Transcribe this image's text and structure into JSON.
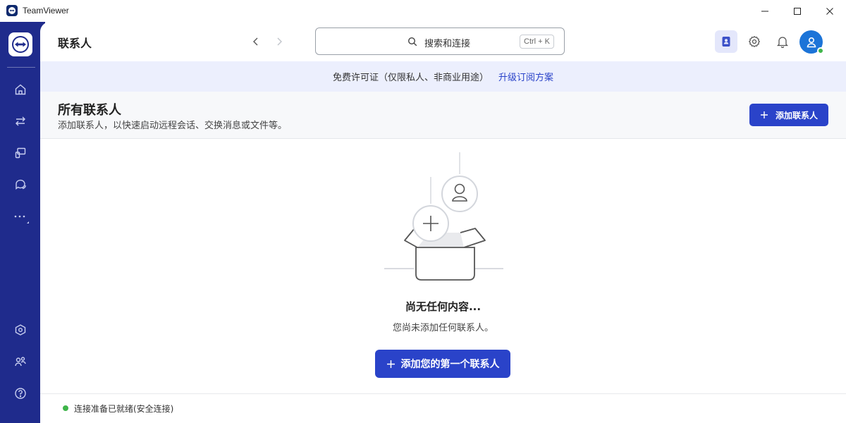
{
  "window": {
    "title": "TeamViewer",
    "controls": [
      "minimize-icon",
      "maximize-icon",
      "close-icon"
    ]
  },
  "sidebar": {
    "logo": "teamviewer-logo-icon",
    "items": [
      {
        "icon": "home-icon"
      },
      {
        "icon": "transfer-arrows-icon"
      },
      {
        "icon": "remote-device-icon"
      },
      {
        "icon": "chat-icon"
      },
      {
        "icon": "more-icon"
      }
    ],
    "bottom_items": [
      {
        "icon": "settings-shield-icon"
      },
      {
        "icon": "people-icon"
      },
      {
        "icon": "help-icon"
      }
    ]
  },
  "header": {
    "title": "联系人",
    "search_placeholder": "搜索和连接",
    "search_shortcut": "Ctrl + K",
    "icons": [
      "contacts-book-icon",
      "gear-icon",
      "bell-icon",
      "user-avatar-icon"
    ]
  },
  "banner": {
    "text": "免费许可证（仅限私人、非商业用途）",
    "link": "升级订阅方案"
  },
  "section": {
    "title": "所有联系人",
    "subtitle": "添加联系人，以快速启动远程会话、交换消息或文件等。",
    "add_button": "添加联系人"
  },
  "empty_state": {
    "title": "尚无任何内容...",
    "subtitle": "您尚未添加任何联系人。",
    "button": "添加您的第一个联系人"
  },
  "status": {
    "text": "连接准备已就绪(安全连接)",
    "color": "#3fb54a"
  },
  "colors": {
    "sidebar": "#1f2b8c",
    "primary": "#2a43c9",
    "banner_bg": "#eceffd",
    "avatar": "#1c74d8"
  }
}
